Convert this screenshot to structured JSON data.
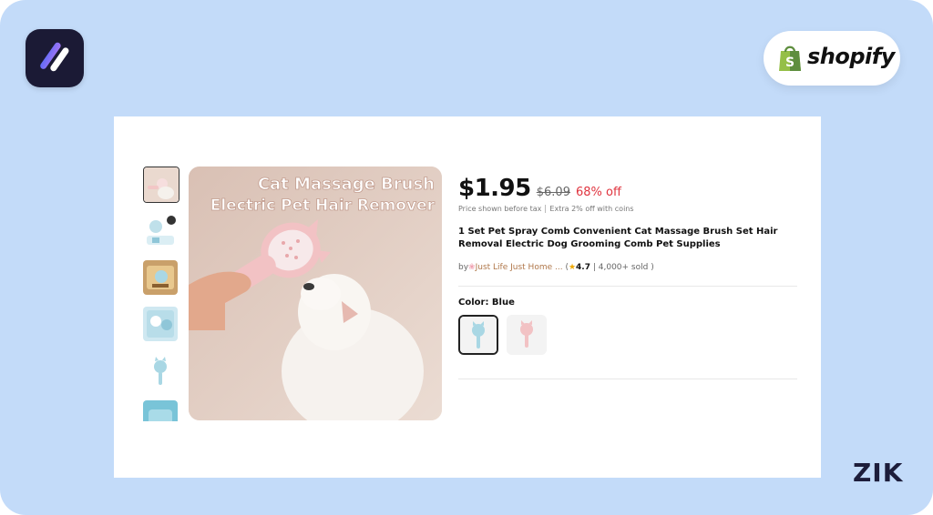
{
  "brand": {
    "app_logo_icon": "stripes-logo-icon",
    "shopify_word": "shopify",
    "shopify_icon": "shopify-bag-icon",
    "watermark": "ZIK"
  },
  "product": {
    "image_text_line1": "Cat Massage Brush",
    "image_text_line2": "Electric Pet Hair Remover",
    "price": "$1.95",
    "original_price": "$6.09",
    "discount": "68% off",
    "price_note": "Price shown before tax",
    "coins_note": "Extra 2% off with coins",
    "title": "1 Set Pet Spray Comb Convenient Cat Massage Brush Set Hair Removal Electric Dog Grooming Comb Pet Supplies",
    "by": "by",
    "seller": "Just Life Just Home ...",
    "rating_open": "(",
    "rating": "4.7",
    "sold": "| 4,000+ sold )",
    "color_label": "Color: Blue"
  },
  "thumbnails": [
    "main",
    "blue-cat-pack",
    "boxed-set",
    "blue-package",
    "blue-comb",
    "blue-detail"
  ],
  "swatches": [
    "Blue",
    "Pink"
  ],
  "colors": {
    "background": "#c3dbf9",
    "discount": "#e0343f",
    "seller": "#b0774a",
    "star": "#f0a800",
    "blue_comb": "#a9d7e4",
    "pink_comb": "#f2c2c4"
  }
}
